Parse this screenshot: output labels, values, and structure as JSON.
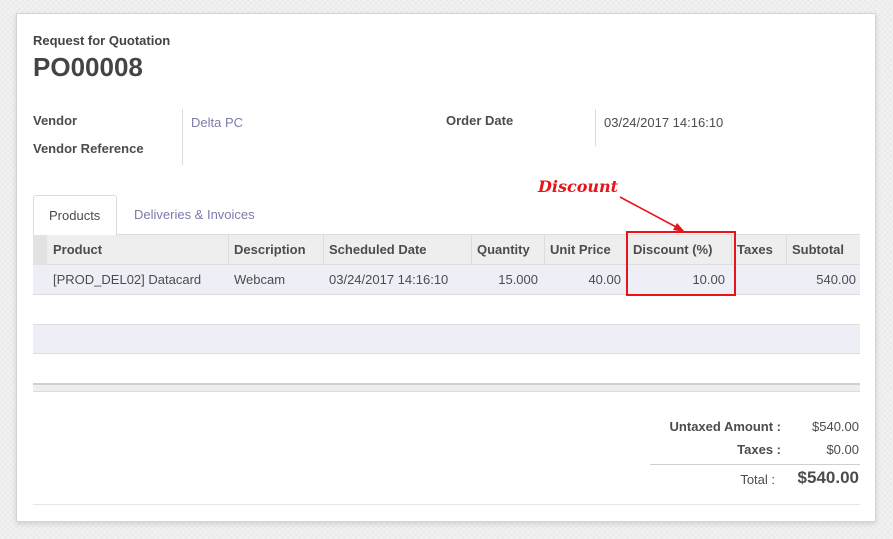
{
  "header": {
    "subtitle": "Request for Quotation",
    "title": "PO00008"
  },
  "fields": {
    "vendor_label": "Vendor",
    "vendor_value": "Delta PC",
    "vendor_ref_label": "Vendor Reference",
    "vendor_ref_value": "",
    "order_date_label": "Order Date",
    "order_date_value": "03/24/2017 14:16:10"
  },
  "tabs": [
    {
      "label": "Products",
      "active": true
    },
    {
      "label": "Deliveries & Invoices",
      "active": false
    }
  ],
  "table": {
    "columns": [
      "Product",
      "Description",
      "Scheduled Date",
      "Quantity",
      "Unit Price",
      "Discount (%)",
      "Taxes",
      "Subtotal"
    ],
    "rows": [
      {
        "product": "[PROD_DEL02] Datacard",
        "description": "Webcam",
        "scheduled_date": "03/24/2017 14:16:10",
        "quantity": "15.000",
        "unit_price": "40.00",
        "discount": "10.00",
        "taxes": "",
        "subtotal": "540.00"
      }
    ]
  },
  "totals": {
    "untaxed_label": "Untaxed Amount :",
    "untaxed_value": "$540.00",
    "taxes_label": "Taxes :",
    "taxes_value": "$0.00",
    "total_label": "Total :",
    "total_value": "$540.00"
  },
  "annotation": {
    "label": "Discount",
    "color": "#e8141b"
  },
  "colors": {
    "link": "#7c7bad",
    "row_highlight": "#eeeef6",
    "header_bg": "#eeeeee"
  }
}
